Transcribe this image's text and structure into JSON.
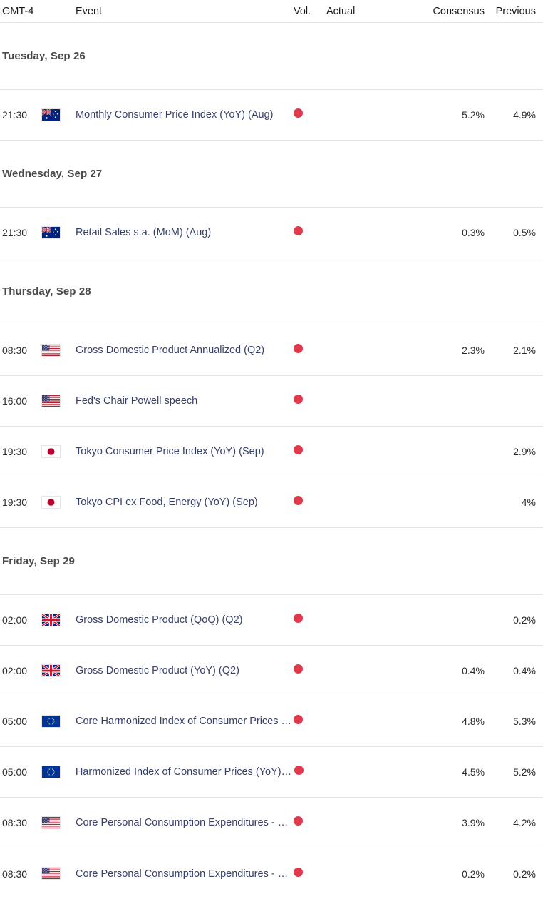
{
  "header": {
    "timezone": "GMT-4",
    "event": "Event",
    "vol": "Vol.",
    "actual": "Actual",
    "consensus": "Consensus",
    "previous": "Previous"
  },
  "colors": {
    "volatility_high": "#e03a4c",
    "event_link": "#37406c",
    "date_header": "#4a4a4a",
    "row_divider": "#e3e3e3"
  },
  "groups": [
    {
      "date": "Tuesday, Sep 26",
      "events": [
        {
          "time": "21:30",
          "flag": "australia-flag",
          "name": "Monthly Consumer Price Index (YoY) (Aug)",
          "volatility": "high",
          "actual": "",
          "consensus": "5.2%",
          "previous": "4.9%"
        }
      ]
    },
    {
      "date": "Wednesday, Sep 27",
      "events": [
        {
          "time": "21:30",
          "flag": "australia-flag",
          "name": "Retail Sales s.a. (MoM) (Aug)",
          "volatility": "high",
          "actual": "",
          "consensus": "0.3%",
          "previous": "0.5%"
        }
      ]
    },
    {
      "date": "Thursday, Sep 28",
      "events": [
        {
          "time": "08:30",
          "flag": "usa-flag",
          "name": "Gross Domestic Product Annualized (Q2)",
          "volatility": "high",
          "actual": "",
          "consensus": "2.3%",
          "previous": "2.1%"
        },
        {
          "time": "16:00",
          "flag": "usa-flag",
          "name": "Fed's Chair Powell speech",
          "volatility": "high",
          "actual": "",
          "consensus": "",
          "previous": ""
        },
        {
          "time": "19:30",
          "flag": "japan-flag",
          "name": "Tokyo Consumer Price Index (YoY) (Sep)",
          "volatility": "high",
          "actual": "",
          "consensus": "",
          "previous": "2.9%"
        },
        {
          "time": "19:30",
          "flag": "japan-flag",
          "name": "Tokyo CPI ex Food, Energy (YoY) (Sep)",
          "volatility": "high",
          "actual": "",
          "consensus": "",
          "previous": "4%"
        }
      ]
    },
    {
      "date": "Friday, Sep 29",
      "events": [
        {
          "time": "02:00",
          "flag": "uk-flag",
          "name": "Gross Domestic Product (QoQ) (Q2)",
          "volatility": "high",
          "actual": "",
          "consensus": "",
          "previous": "0.2%"
        },
        {
          "time": "02:00",
          "flag": "uk-flag",
          "name": "Gross Domestic Product (YoY) (Q2)",
          "volatility": "high",
          "actual": "",
          "consensus": "0.4%",
          "previous": "0.4%"
        },
        {
          "time": "05:00",
          "flag": "eu-flag",
          "name": "Core Harmonized Index of Consumer Prices …",
          "volatility": "high",
          "actual": "",
          "consensus": "4.8%",
          "previous": "5.3%"
        },
        {
          "time": "05:00",
          "flag": "eu-flag",
          "name": "Harmonized Index of Consumer Prices (YoY) …",
          "volatility": "high",
          "actual": "",
          "consensus": "4.5%",
          "previous": "5.2%"
        },
        {
          "time": "08:30",
          "flag": "usa-flag",
          "name": "Core Personal Consumption Expenditures - …",
          "volatility": "high",
          "actual": "",
          "consensus": "3.9%",
          "previous": "4.2%"
        },
        {
          "time": "08:30",
          "flag": "usa-flag",
          "name": "Core Personal Consumption Expenditures - …",
          "volatility": "high",
          "actual": "",
          "consensus": "0.2%",
          "previous": "0.2%"
        }
      ]
    }
  ]
}
